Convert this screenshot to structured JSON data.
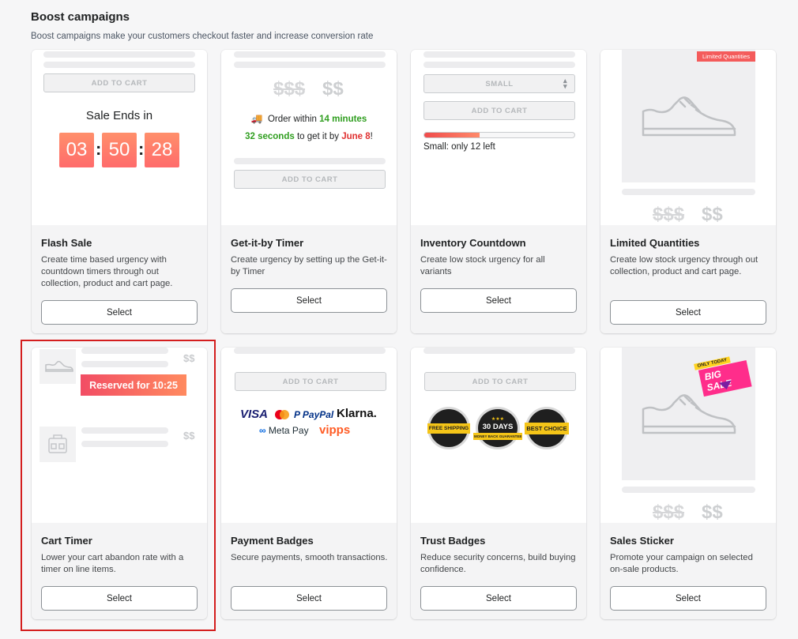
{
  "header": {
    "title": "Boost campaigns",
    "subtitle": "Boost campaigns make your customers checkout faster and increase conversion rate"
  },
  "common": {
    "select_label": "Select",
    "add_to_cart": "ADD TO CART",
    "price_old": "$$$",
    "price_new": "$$",
    "price_small": "$$"
  },
  "cards": [
    {
      "title": "Flash Sale",
      "desc": "Create time based urgency with countdown timers through out collection, product and cart page.",
      "preview": {
        "heading": "Sale Ends in",
        "hours": "03",
        "minutes": "50",
        "seconds": "28",
        "colon": ":"
      }
    },
    {
      "title": "Get-it-by Timer",
      "desc": "Create urgency by setting up the Get-it-by Timer",
      "preview": {
        "truck": "🚚",
        "line1_pre": "Order within",
        "line1_time": "14 minutes",
        "line2_time": "32 seconds",
        "line2_mid": "to get it by",
        "line2_date": "June 8",
        "line2_end": "!"
      }
    },
    {
      "title": "Inventory Countdown",
      "desc": "Create low stock urgency for all variants",
      "preview": {
        "variant": "SMALL",
        "stock_text": "Small: only 12 left",
        "stock_progress": 0.37
      }
    },
    {
      "title": "Limited Quantities",
      "desc": "Create low stock urgency through out collection, product and cart page.",
      "preview": {
        "ribbon": "Limited Quantities"
      }
    },
    {
      "title": "Cart Timer",
      "desc": "Lower your cart abandon rate with a timer on line items.",
      "preview": {
        "reserved": "Reserved for 10:25"
      }
    },
    {
      "title": "Payment Badges",
      "desc": "Secure payments, smooth transactions.",
      "preview": {
        "visa": "VISA",
        "paypal": "PayPal",
        "klarna": "Klarna.",
        "metapay": "Meta Pay",
        "vipps": "vipps"
      }
    },
    {
      "title": "Trust Badges",
      "desc": "Reduce security concerns, build buying confidence.",
      "preview": {
        "badge1": "FREE SHIPPING",
        "badge2_top": "30 DAYS",
        "badge2_bottom": "MONEY BACK GUARANTEE",
        "badge3": "BEST CHOICE"
      }
    },
    {
      "title": "Sales Sticker",
      "desc": "Promote your campaign on selected on-sale products.",
      "preview": {
        "sticker_top": "ONLY TODAY",
        "sticker_main": "BIG SALE"
      }
    }
  ],
  "colors": {
    "accent_red": "#d41e1e",
    "timer_gradient": "#ff7a6a",
    "green": "#2f9e1f",
    "red_text": "#e03131"
  }
}
